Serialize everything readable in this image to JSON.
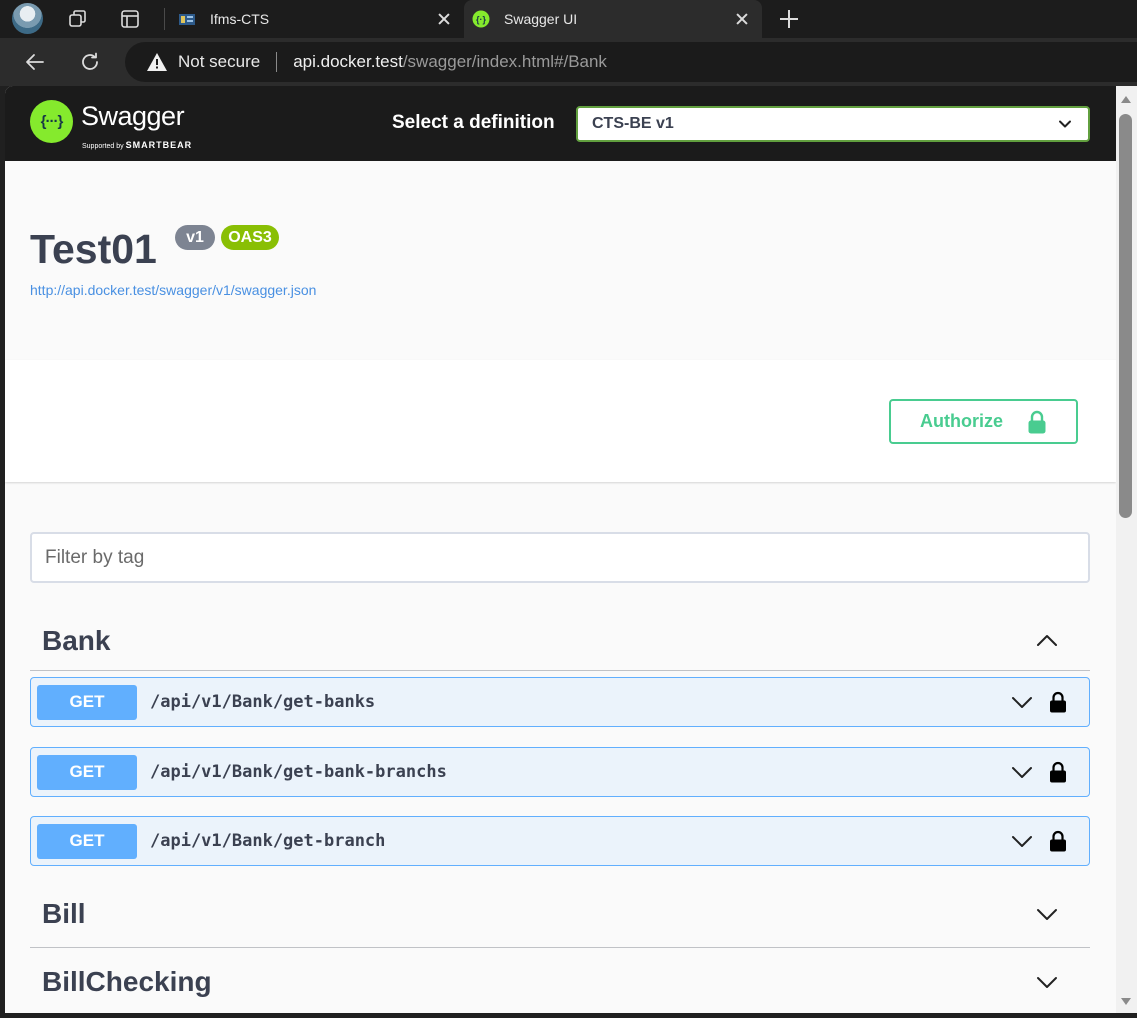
{
  "browser": {
    "tabs": [
      {
        "title": "Ifms-CTS",
        "active": false
      },
      {
        "title": "Swagger UI",
        "active": true
      }
    ],
    "address": {
      "security": "Not secure",
      "host": "api.docker.test",
      "path": "/swagger/index.html#/Bank"
    }
  },
  "topbar": {
    "logo_text": "Swagger",
    "logo_glyph": "{···}",
    "logo_sub_prefix": "Supported by",
    "logo_sub_brand": "SMARTBEAR",
    "select_label": "Select a definition",
    "selected_definition": "CTS-BE v1"
  },
  "info": {
    "title": "Test01",
    "version_badge": "v1",
    "oas_badge": "OAS3",
    "spec_url": "http://api.docker.test/swagger/v1/swagger.json"
  },
  "authorize": {
    "label": "Authorize"
  },
  "filter": {
    "placeholder": "Filter by tag",
    "value": ""
  },
  "tags": [
    {
      "name": "Bank",
      "expanded": true,
      "operations": [
        {
          "method": "GET",
          "path": "/api/v1/Bank/get-banks"
        },
        {
          "method": "GET",
          "path": "/api/v1/Bank/get-bank-branchs"
        },
        {
          "method": "GET",
          "path": "/api/v1/Bank/get-branch"
        }
      ]
    },
    {
      "name": "Bill",
      "expanded": false,
      "operations": []
    },
    {
      "name": "BillChecking",
      "expanded": false,
      "operations": []
    }
  ],
  "colors": {
    "swagger_green": "#85ea2d",
    "authorize_green": "#49cc90",
    "get_blue": "#61affe",
    "get_bg": "#ebf3fb",
    "text_dark": "#3b4151",
    "link_blue": "#4990e2"
  },
  "icons": [
    "profile-avatar",
    "workspaces-icon",
    "tab-actions-icon",
    "close-icon",
    "new-tab-icon",
    "back-icon",
    "reload-icon",
    "warning-icon",
    "chevron-down-icon",
    "chevron-up-icon",
    "lock-icon"
  ]
}
